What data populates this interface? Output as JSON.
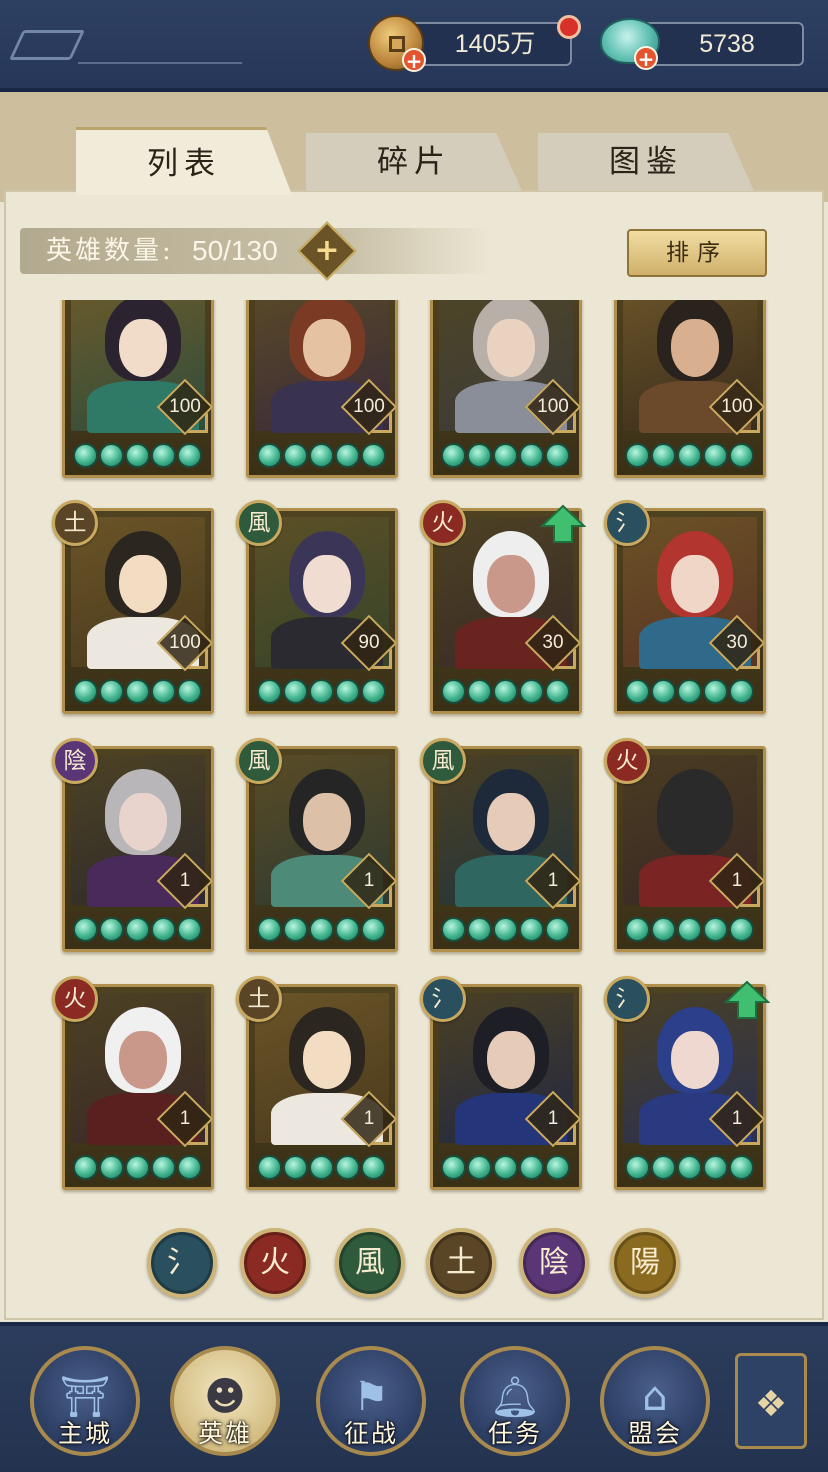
{
  "resources": {
    "coins": "1405万",
    "jade": "5738"
  },
  "tabs": [
    {
      "label": "列表",
      "active": true
    },
    {
      "label": "碎片",
      "active": false
    },
    {
      "label": "图鉴",
      "active": false
    }
  ],
  "hero_count": {
    "label": "英雄数量:",
    "value": "50/130"
  },
  "sort_button": "排序",
  "elements": {
    "water": "氵",
    "fire": "火",
    "wind": "風",
    "earth": "土",
    "yin": "陰",
    "yang": "陽"
  },
  "heroes": [
    {
      "level": "100",
      "element": null,
      "upgrade": false
    },
    {
      "level": "100",
      "element": null,
      "upgrade": false
    },
    {
      "level": "100",
      "element": null,
      "upgrade": false
    },
    {
      "level": "100",
      "element": null,
      "upgrade": false
    },
    {
      "level": "100",
      "element": "earth",
      "upgrade": false
    },
    {
      "level": "90",
      "element": "wind",
      "upgrade": false
    },
    {
      "level": "30",
      "element": "fire",
      "upgrade": true
    },
    {
      "level": "30",
      "element": "water",
      "upgrade": false
    },
    {
      "level": "1",
      "element": "yin",
      "upgrade": false
    },
    {
      "level": "1",
      "element": "wind",
      "upgrade": false
    },
    {
      "level": "1",
      "element": "wind",
      "upgrade": false
    },
    {
      "level": "1",
      "element": "fire",
      "upgrade": false
    },
    {
      "level": "1",
      "element": "fire",
      "upgrade": false
    },
    {
      "level": "1",
      "element": "earth",
      "upgrade": false
    },
    {
      "level": "1",
      "element": "water",
      "upgrade": false
    },
    {
      "level": "1",
      "element": "water",
      "upgrade": true
    }
  ],
  "element_colors": {
    "water": "#2a4f5e",
    "fire": "#8a2a22",
    "wind": "#2f5a3c",
    "earth": "#5a4527",
    "yin": "#5b3677",
    "yang": "#8a6a1e"
  },
  "filters": [
    "water",
    "fire",
    "wind",
    "earth",
    "yin",
    "yang"
  ],
  "bottom_nav": [
    {
      "label": "主城",
      "icon": "palace-icon"
    },
    {
      "label": "英雄",
      "icon": "hero-portrait-icon"
    },
    {
      "label": "征战",
      "icon": "horn-icon"
    },
    {
      "label": "任务",
      "icon": "bell-icon"
    },
    {
      "label": "盟会",
      "icon": "pavilion-icon"
    }
  ]
}
